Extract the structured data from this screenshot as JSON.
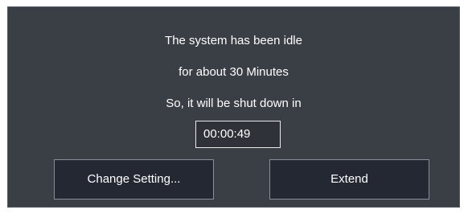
{
  "dialog": {
    "message_line_1": "The system has been idle",
    "message_line_2": "for about  30 Minutes",
    "message_line_3": "So, it will be shut down in",
    "countdown_value": "00:00:49",
    "buttons": {
      "change_setting_label": "Change Setting...",
      "extend_label": "Extend"
    }
  },
  "colors": {
    "dialog_background": "#3a3e45",
    "button_background": "#232833",
    "text": "#ffffff"
  }
}
